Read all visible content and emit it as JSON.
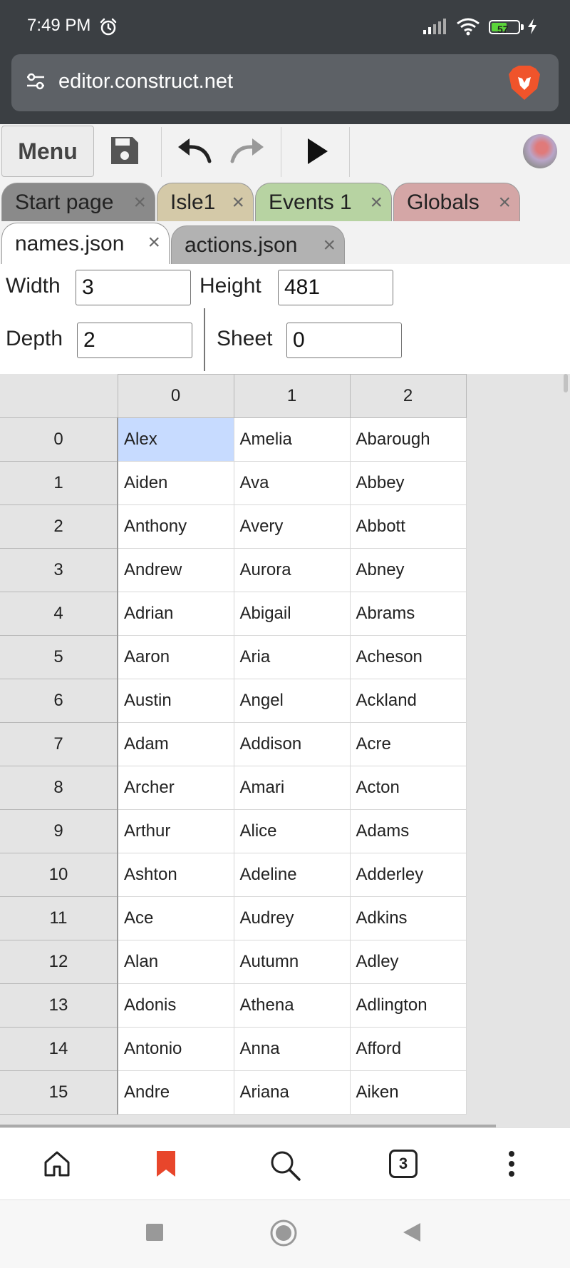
{
  "status": {
    "time": "7:49 PM",
    "battery": "57",
    "battery_level": 0.57
  },
  "browser": {
    "url": "editor.construct.net",
    "open_tabs": "3"
  },
  "toolbar": {
    "menu_label": "Menu"
  },
  "tabs": [
    {
      "label": "Start page",
      "color": "#8a8a8a"
    },
    {
      "label": "Isle1",
      "color": "#d4c9a8"
    },
    {
      "label": "Events 1",
      "color": "#b7d3a2"
    },
    {
      "label": "Globals",
      "color": "#d4a6a6"
    },
    {
      "label": "names.json",
      "color": "#ffffff",
      "active": true
    },
    {
      "label": "actions.json",
      "color": "#b2b2b2"
    }
  ],
  "tab_close_glyph": "×",
  "properties": {
    "width_label": "Width",
    "width_value": "3",
    "height_label": "Height",
    "height_value": "481",
    "depth_label": "Depth",
    "depth_value": "2",
    "sheet_label": "Sheet",
    "sheet_value": "0"
  },
  "grid": {
    "columns": [
      "0",
      "1",
      "2"
    ],
    "rows": [
      {
        "index": "0",
        "cells": [
          "Alex",
          "Amelia",
          "Abarough"
        ]
      },
      {
        "index": "1",
        "cells": [
          "Aiden",
          "Ava",
          "Abbey"
        ]
      },
      {
        "index": "2",
        "cells": [
          "Anthony",
          "Avery",
          "Abbott"
        ]
      },
      {
        "index": "3",
        "cells": [
          "Andrew",
          "Aurora",
          "Abney"
        ]
      },
      {
        "index": "4",
        "cells": [
          "Adrian",
          "Abigail",
          "Abrams"
        ]
      },
      {
        "index": "5",
        "cells": [
          "Aaron",
          "Aria",
          "Acheson"
        ]
      },
      {
        "index": "6",
        "cells": [
          "Austin",
          "Angel",
          "Ackland"
        ]
      },
      {
        "index": "7",
        "cells": [
          "Adam",
          "Addison",
          "Acre"
        ]
      },
      {
        "index": "8",
        "cells": [
          "Archer",
          "Amari",
          "Acton"
        ]
      },
      {
        "index": "9",
        "cells": [
          "Arthur",
          "Alice",
          "Adams"
        ]
      },
      {
        "index": "10",
        "cells": [
          "Ashton",
          "Adeline",
          "Adderley"
        ]
      },
      {
        "index": "11",
        "cells": [
          "Ace",
          "Audrey",
          "Adkins"
        ]
      },
      {
        "index": "12",
        "cells": [
          "Alan",
          "Autumn",
          "Adley"
        ]
      },
      {
        "index": "13",
        "cells": [
          "Adonis",
          "Athena",
          "Adlington"
        ]
      },
      {
        "index": "14",
        "cells": [
          "Antonio",
          "Anna",
          "Afford"
        ]
      },
      {
        "index": "15",
        "cells": [
          "Andre",
          "Ariana",
          "Aiken"
        ]
      }
    ],
    "selected": {
      "row": 0,
      "col": 0
    }
  },
  "colors": {
    "brave_orange": "#f0542b",
    "bookmark_red": "#e8462b",
    "selection": "#c7dbff"
  },
  "icons": {
    "status": [
      "alarm-icon",
      "signal-icon",
      "wifi-icon",
      "battery-icon",
      "charge-icon"
    ],
    "address": [
      "site-settings-icon",
      "brave-icon"
    ],
    "toolbar": [
      "save-icon",
      "undo-icon",
      "redo-icon",
      "play-icon"
    ],
    "browser_nav": [
      "home-icon",
      "bookmark-icon",
      "search-icon",
      "tabs-icon",
      "more-icon"
    ],
    "system_nav": [
      "recents-icon",
      "home-circle-icon",
      "back-icon"
    ]
  }
}
